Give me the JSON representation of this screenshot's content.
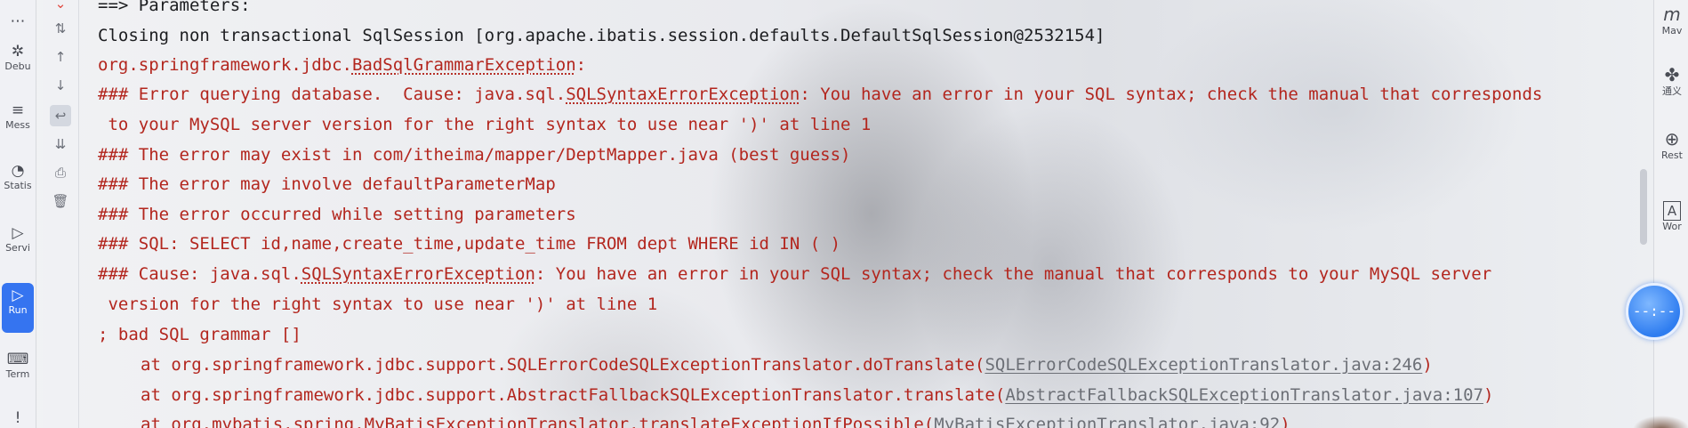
{
  "left_toolbar": [
    {
      "name": "more",
      "icon": "ellipsis-icon",
      "glyph": "⋯",
      "label": ""
    },
    {
      "name": "debug",
      "icon": "bug-icon",
      "glyph": "✲",
      "label": "Debu"
    },
    {
      "name": "messages",
      "icon": "list-icon",
      "glyph": "≡",
      "label": "Mess"
    },
    {
      "name": "statistics",
      "icon": "pie-chart-icon",
      "glyph": "◔",
      "label": "Statis"
    },
    {
      "name": "services",
      "icon": "play-circle-icon",
      "glyph": "▷",
      "label": "Servi"
    },
    {
      "name": "run",
      "icon": "run-icon",
      "glyph": "▷",
      "label": "Run"
    },
    {
      "name": "terminal",
      "icon": "terminal-icon",
      "glyph": "⌨",
      "label": "Term"
    },
    {
      "name": "problems",
      "icon": "alert-icon",
      "glyph": "!",
      "label": ""
    }
  ],
  "console_actions": [
    {
      "icon": "chevron-down-icon",
      "glyph": "⌄",
      "color": "#e0463c"
    },
    {
      "icon": "sort-icon",
      "glyph": "⇅"
    },
    {
      "icon": "arrow-up-icon",
      "glyph": "↑"
    },
    {
      "icon": "arrow-down-icon",
      "glyph": "↓"
    },
    {
      "icon": "soft-wrap-icon",
      "glyph": "↩"
    },
    {
      "icon": "scroll-to-end-icon",
      "glyph": "⇊"
    },
    {
      "icon": "print-icon",
      "glyph": "⎙"
    },
    {
      "icon": "trash-icon",
      "glyph": "🗑"
    }
  ],
  "console": {
    "l1": "==> Parameters: ",
    "l2": "Closing non transactional SqlSession [org.apache.ibatis.session.defaults.DefaultSqlSession@2532154]",
    "l3_prefix": "org.springframework.jdbc.",
    "l3_link": "BadSqlGrammarException",
    "l3_suffix": ":",
    "l4_prefix": "### Error querying database.  Cause: java.sql.",
    "l4_link": "SQLSyntaxErrorException",
    "l4_suffix": ": You have an error in your SQL syntax; check the manual that corresponds",
    "l5": " to your MySQL server version for the right syntax to use near ')' at line 1",
    "l6": "### The error may exist in com/itheima/mapper/DeptMapper.java (best guess)",
    "l7": "### The error may involve defaultParameterMap",
    "l8": "### The error occurred while setting parameters",
    "l9": "### SQL: SELECT id,name,create_time,update_time FROM dept WHERE id IN ( )",
    "l10_prefix": "### Cause: java.sql.",
    "l10_link": "SQLSyntaxErrorException",
    "l10_suffix": ": You have an error in your SQL syntax; check the manual that corresponds to your MySQL server",
    "l11": " version for the right syntax to use near ')' at line 1",
    "l12": "; bad SQL grammar []",
    "l13_prefix": "at org.springframework.jdbc.support.SQLErrorCodeSQLExceptionTranslator.doTranslate(",
    "l13_link": "SQLErrorCodeSQLExceptionTranslator.java:246",
    "l13_suffix": ")",
    "l14_prefix": "at org.springframework.jdbc.support.AbstractFallbackSQLExceptionTranslator.translate(",
    "l14_link": "AbstractFallbackSQLExceptionTranslator.java:107",
    "l14_suffix": ")",
    "l15_prefix": "at org.mybatis.spring.MyBatisExceptionTranslator.translateExceptionIfPossible(",
    "l15_link": "MyBatisExceptionTranslator.java:92",
    "l15_suffix": ")"
  },
  "right_toolbar": [
    {
      "name": "maven",
      "icon": "maven-icon",
      "glyph": "m",
      "label": "Mav"
    },
    {
      "name": "tongyi",
      "icon": "tongyi-icon",
      "glyph": "✤",
      "label": "通义"
    },
    {
      "name": "rest",
      "icon": "globe-icon",
      "glyph": "⊕",
      "label": "Rest"
    },
    {
      "name": "word",
      "icon": "word-book-icon",
      "glyph": "A",
      "label": "Wor"
    }
  ],
  "colors": {
    "error_text": "#b3261e",
    "plain_text": "#1c1d20",
    "link_text": "#6c6f76",
    "run_accent": "#3574f0"
  }
}
